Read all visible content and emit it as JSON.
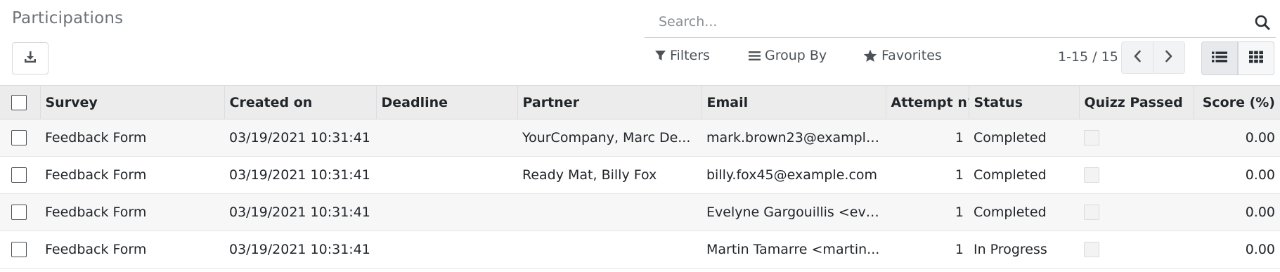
{
  "page": {
    "title": "Participations"
  },
  "search": {
    "placeholder": "Search..."
  },
  "toolbar": {
    "filters_label": "Filters",
    "group_by_label": "Group By",
    "favorites_label": "Favorites"
  },
  "pager": {
    "value": "1-15 / 15"
  },
  "icons": {
    "download": "download-icon",
    "search": "search-icon",
    "filter": "filter-icon",
    "group_by": "bars-icon",
    "favorites": "star-icon",
    "prev": "chevron-left-icon",
    "next": "chevron-right-icon",
    "list_view": "list-view-icon",
    "kanban_view": "kanban-view-icon"
  },
  "table": {
    "columns": {
      "survey": "Survey",
      "created_on": "Created on",
      "deadline": "Deadline",
      "partner": "Partner",
      "email": "Email",
      "attempt": "Attempt n°",
      "status": "Status",
      "quizz_passed": "Quizz Passed",
      "score": "Score (%)"
    },
    "rows": [
      {
        "survey": "Feedback Form",
        "created_on": "03/19/2021 10:31:41",
        "deadline": "",
        "partner": "YourCompany, Marc De...",
        "email": "mark.brown23@example...",
        "attempt": "1",
        "status": "Completed",
        "score": "0.00"
      },
      {
        "survey": "Feedback Form",
        "created_on": "03/19/2021 10:31:41",
        "deadline": "",
        "partner": "Ready Mat, Billy Fox",
        "email": "billy.fox45@example.com",
        "attempt": "1",
        "status": "Completed",
        "score": "0.00"
      },
      {
        "survey": "Feedback Form",
        "created_on": "03/19/2021 10:31:41",
        "deadline": "",
        "partner": "",
        "email": "Evelyne Gargouillis <evel...",
        "attempt": "1",
        "status": "Completed",
        "score": "0.00"
      },
      {
        "survey": "Feedback Form",
        "created_on": "03/19/2021 10:31:41",
        "deadline": "",
        "partner": "",
        "email": "Martin Tamarre <martin...",
        "attempt": "1",
        "status": "In Progress",
        "score": "0.00"
      }
    ]
  }
}
